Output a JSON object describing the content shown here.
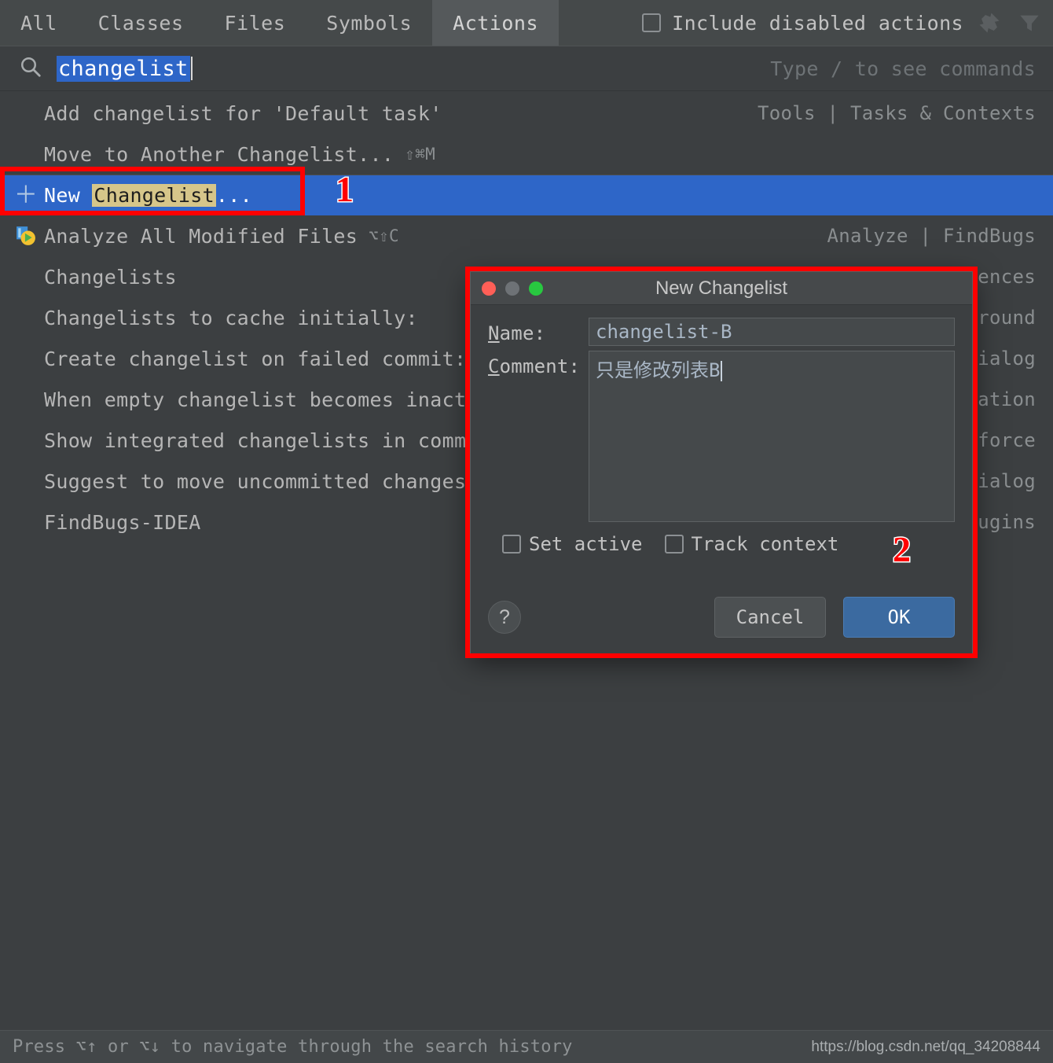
{
  "tabs": [
    {
      "label": "All",
      "active": false
    },
    {
      "label": "Classes",
      "active": false
    },
    {
      "label": "Files",
      "active": false
    },
    {
      "label": "Symbols",
      "active": false
    },
    {
      "label": "Actions",
      "active": true
    }
  ],
  "toolbar": {
    "include_disabled_label": "Include disabled actions",
    "include_disabled_checked": false,
    "pin_icon": "pin-icon",
    "filter_icon": "filter-icon"
  },
  "search": {
    "icon": "search-icon",
    "value": "changelist",
    "hint": "Type / to see commands"
  },
  "results": [
    {
      "icon": "",
      "label": "Add changelist for 'Default task'",
      "shortcut": "",
      "group": "Tools | Tasks & Contexts",
      "selected": false
    },
    {
      "icon": "",
      "label": "Move to Another Changelist...",
      "shortcut": "⇧⌘M",
      "group": "",
      "selected": false
    },
    {
      "icon": "plus-icon",
      "label_pre": "New ",
      "label_match": "Changelist",
      "label_post": "...",
      "shortcut": "",
      "group": "",
      "selected": true
    },
    {
      "icon": "findbugs-icon",
      "label": "Analyze All Modified Files",
      "shortcut": "⌥⇧C",
      "group": "Analyze | FindBugs",
      "selected": false
    },
    {
      "icon": "",
      "label": "Changelists",
      "shortcut": "",
      "group": "Preferences",
      "selected": false
    },
    {
      "icon": "",
      "label": "Changelists to cache initially:",
      "shortcut": "",
      "group": "Background",
      "selected": false
    },
    {
      "icon": "",
      "label": "Create changelist on failed commit:",
      "shortcut": "",
      "group": "Dialog",
      "selected": false
    },
    {
      "icon": "",
      "label": "When empty changelist becomes inactive",
      "shortcut": "",
      "group": "Information",
      "selected": false
    },
    {
      "icon": "",
      "label": "Show integrated changelists in committe",
      "shortcut": "",
      "group": "Perforce",
      "selected": false
    },
    {
      "icon": "",
      "label": "Suggest to move uncommitted changes to",
      "shortcut": "",
      "group": "Dialog",
      "selected": false
    },
    {
      "icon": "",
      "label": "FindBugs-IDEA",
      "shortcut": "",
      "group": "Plugins",
      "selected": false
    }
  ],
  "dialog": {
    "title": "New Changelist",
    "name_label_mnemonic": "N",
    "name_label_rest": "ame:",
    "name_value": "changelist-B",
    "comment_label_mnemonic": "C",
    "comment_label_rest": "omment:",
    "comment_value": "只是修改列表B",
    "set_active_label": "Set active",
    "set_active_checked": false,
    "track_context_label": "Track context",
    "track_context_checked": false,
    "help_label": "?",
    "cancel_label": "Cancel",
    "ok_label": "OK"
  },
  "annotations": [
    {
      "number": "1"
    },
    {
      "number": "2"
    }
  ],
  "statusbar": {
    "hint": "Press ⌥↑ or ⌥↓ to navigate through the search history",
    "watermark": "https://blog.csdn.net/qq_34208844"
  },
  "colors": {
    "background": "#3C3F41",
    "tabbar": "#45494A",
    "tab_active": "#55595B",
    "selection_blue": "#2E66C8",
    "match_highlight": "#D6C68A",
    "annotation_red": "#FF0000",
    "primary_button": "#3B6AA0"
  }
}
